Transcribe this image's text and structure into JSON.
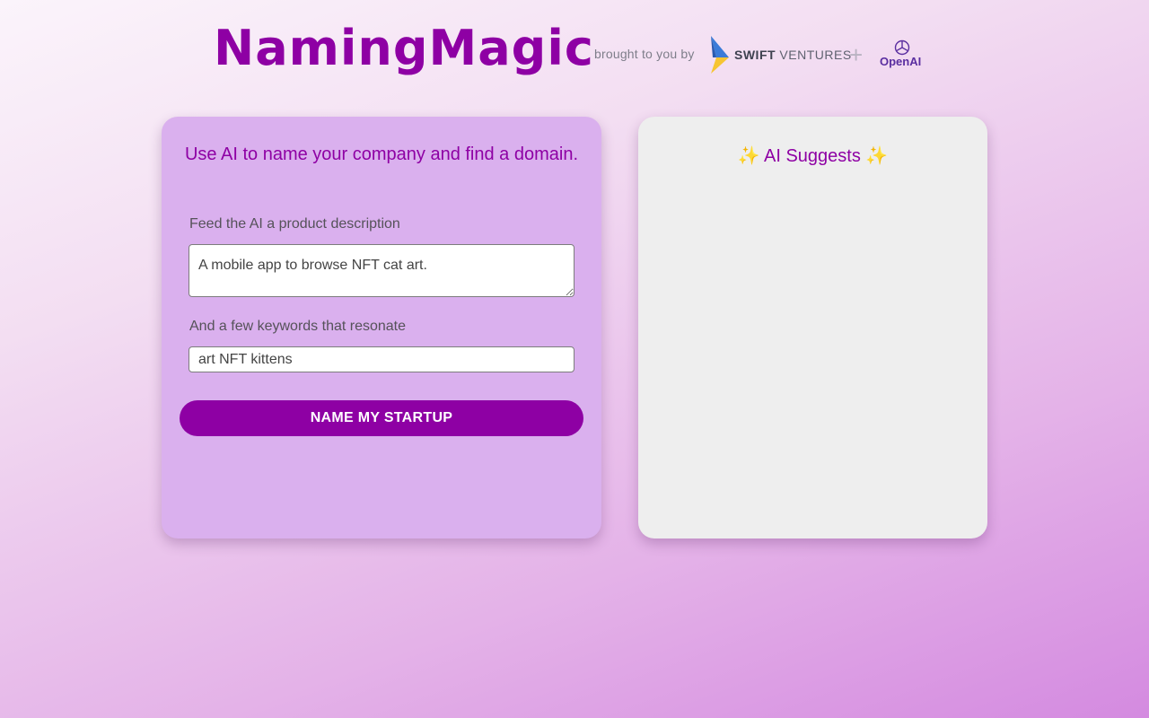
{
  "header": {
    "title": "NamingMagic",
    "brought_by": "brought to you by",
    "sponsor_bold": "SWIFT",
    "sponsor_rest": " VENTURES",
    "plus": "+",
    "partner": "OpenAI"
  },
  "form": {
    "heading": "Use AI to name your company and find a domain.",
    "description_label": "Feed the AI a product description",
    "description_value": "A mobile app to browse NFT cat art.",
    "keywords_label": "And a few keywords that resonate",
    "keywords_value": "art NFT kittens",
    "submit_label": "NAME MY STARTUP"
  },
  "results": {
    "sparkle_left": "✨",
    "heading": "AI Suggests",
    "sparkle_right": "✨"
  },
  "colors": {
    "brand": "#8e00a4",
    "form_card": "#dab0ee",
    "results_card": "#eeeeee"
  }
}
